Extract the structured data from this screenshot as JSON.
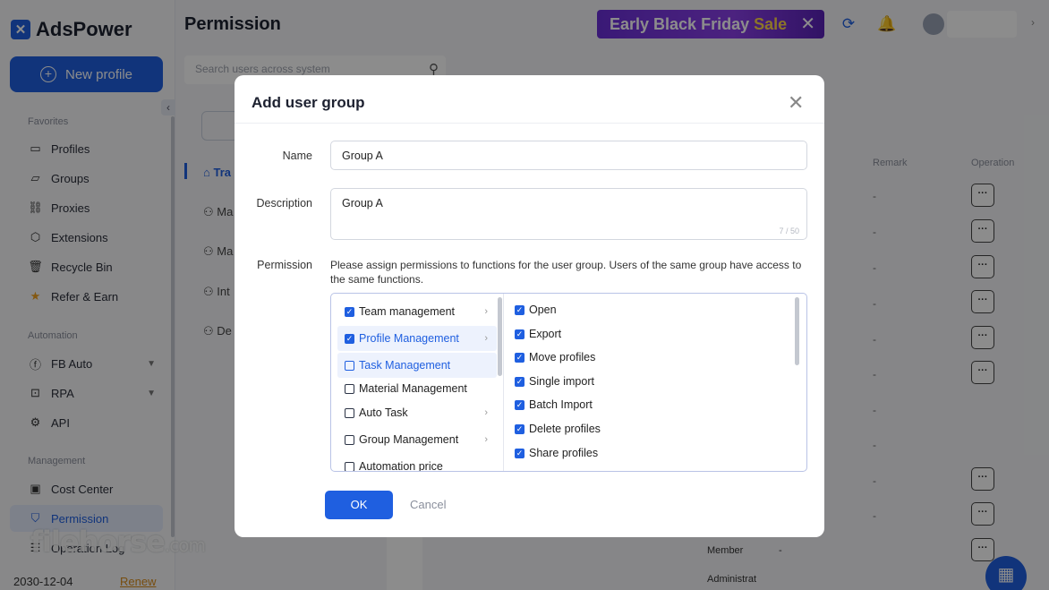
{
  "app": {
    "name": "AdsPower"
  },
  "sidebar": {
    "new_profile": "New profile",
    "sections": {
      "favorites": "Favorites",
      "automation": "Automation",
      "management": "Management"
    },
    "items": [
      {
        "label": "Profiles",
        "icon": "folder-icon"
      },
      {
        "label": "Groups",
        "icon": "folder-open-icon"
      },
      {
        "label": "Proxies",
        "icon": "proxy-icon"
      },
      {
        "label": "Extensions",
        "icon": "box-icon"
      },
      {
        "label": "Recycle Bin",
        "icon": "trash-icon"
      },
      {
        "label": "Refer & Earn",
        "icon": "star-icon"
      },
      {
        "label": "FB Auto",
        "icon": "facebook-icon"
      },
      {
        "label": "RPA",
        "icon": "robot-icon"
      },
      {
        "label": "API",
        "icon": "api-icon"
      },
      {
        "label": "Cost Center",
        "icon": "wallet-icon"
      },
      {
        "label": "Permission",
        "icon": "shield-icon"
      },
      {
        "label": "Operation Log",
        "icon": "log-icon"
      }
    ],
    "expiry_date": "2030-12-04",
    "renew": "Renew"
  },
  "watermark": {
    "main": "filehorse",
    "suffix": ".com"
  },
  "header": {
    "title": "Permission",
    "promo": {
      "text": "Early Black Friday",
      "highlight": "Sale"
    }
  },
  "search": {
    "placeholder": "Search users across system"
  },
  "groups": [
    {
      "label": "Tra"
    },
    {
      "label": "Ma"
    },
    {
      "label": "Ma"
    },
    {
      "label": "Int"
    },
    {
      "label": "De"
    }
  ],
  "table": {
    "headers": {
      "remark": "Remark",
      "operation": "Operation"
    },
    "dash": "-",
    "op_label": "···",
    "visible_cells": {
      "member": "Member",
      "admin": "Administrat"
    }
  },
  "modal": {
    "title": "Add user group",
    "name_label": "Name",
    "name_value": "Group A",
    "description_label": "Description",
    "description_value": "Group A",
    "description_counter": "7 / 50",
    "permission_label": "Permission",
    "permission_desc": "Please assign permissions to functions for the user group. Users of the same group have access to the same functions.",
    "modules": [
      {
        "label": "Team management",
        "checked": true,
        "arrow": true,
        "highlight": false
      },
      {
        "label": "Profile Management",
        "checked": true,
        "arrow": true,
        "highlight": true
      },
      {
        "label": "Task Management",
        "checked": false,
        "arrow": false,
        "highlight": true
      },
      {
        "label": "Material Management",
        "checked": false,
        "arrow": false,
        "highlight": false
      },
      {
        "label": "Auto Task",
        "checked": false,
        "arrow": true,
        "highlight": false
      },
      {
        "label": "Group Management",
        "checked": false,
        "arrow": true,
        "highlight": false
      },
      {
        "label": "Automation price",
        "checked": false,
        "arrow": false,
        "highlight": false
      }
    ],
    "functions": [
      {
        "label": "Open",
        "checked": true
      },
      {
        "label": "Export",
        "checked": true
      },
      {
        "label": "Move profiles",
        "checked": true
      },
      {
        "label": "Single import",
        "checked": true
      },
      {
        "label": "Batch Import",
        "checked": true
      },
      {
        "label": "Delete profiles",
        "checked": true
      },
      {
        "label": "Share profiles",
        "checked": true
      }
    ],
    "ok": "OK",
    "cancel": "Cancel"
  },
  "colors": {
    "accent": "#1f5fe0",
    "promo": "#7a36e0",
    "sale": "#ffd54a",
    "renew": "#d98c1a"
  }
}
